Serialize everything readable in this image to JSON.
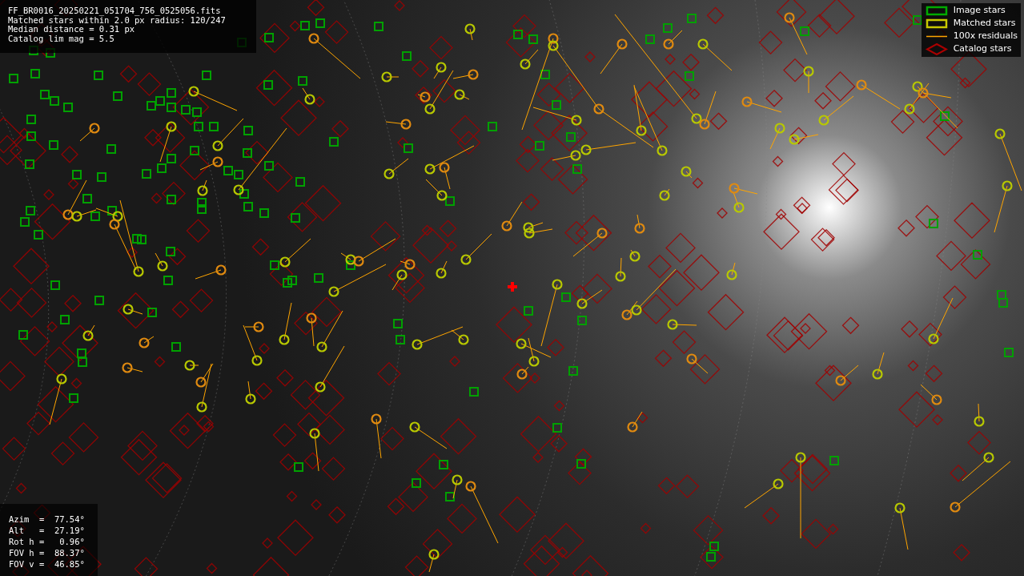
{
  "info": {
    "lines": [
      "FF_BR0016_20250221_051704_756_0525056.fits",
      "Matched stars within 2.0 px radius: 120/247",
      "Median distance = 0.31 px",
      "Catalog lim mag = 5.5"
    ]
  },
  "legend": [
    {
      "kind": "square",
      "color": "#00aa00",
      "label": "Image stars"
    },
    {
      "kind": "square",
      "color": "#c8c800",
      "label": "Matched stars"
    },
    {
      "kind": "line",
      "color": "#ffa500",
      "label": "100x residuals"
    },
    {
      "kind": "diamond",
      "color": "#aa0000",
      "label": "Catalog stars"
    }
  ],
  "pointing": {
    "lines": [
      "Azim  =  77.54°",
      "Alt   =  27.19°",
      "Rot h =   0.96°",
      "FOV h =  88.37°",
      "FOV v =  46.85°"
    ]
  }
}
